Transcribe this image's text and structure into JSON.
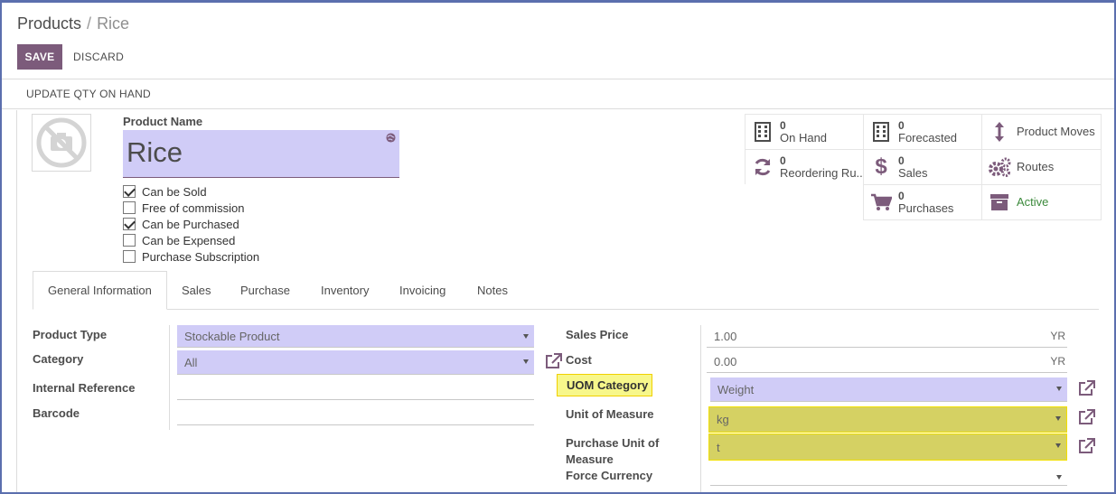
{
  "breadcrumb": {
    "parent": "Products",
    "separator": "/",
    "current": "Rice"
  },
  "buttons": {
    "save": "SAVE",
    "discard": "DISCARD",
    "update_qty": "UPDATE QTY ON HAND"
  },
  "product": {
    "name_label": "Product Name",
    "name": "Rice",
    "checkboxes": [
      {
        "label": "Can be Sold",
        "checked": true
      },
      {
        "label": "Free of commission",
        "checked": false
      },
      {
        "label": "Can be Purchased",
        "checked": true
      },
      {
        "label": "Can be Expensed",
        "checked": false
      },
      {
        "label": "Purchase Subscription",
        "checked": false
      }
    ]
  },
  "smart_buttons": {
    "on_hand": {
      "value": "0",
      "label": "On Hand",
      "icon": "building-icon"
    },
    "forecasted": {
      "value": "0",
      "label": "Forecasted",
      "icon": "building-icon"
    },
    "product_moves": {
      "label": "Product Moves",
      "icon": "arrows-v-icon"
    },
    "reordering": {
      "value": "0",
      "label": "Reordering Ru...",
      "icon": "refresh-icon"
    },
    "sales": {
      "value": "0",
      "label": "Sales",
      "icon": "dollar-icon"
    },
    "routes": {
      "label": "Routes",
      "icon": "cogs-icon"
    },
    "purchases": {
      "value": "0",
      "label": "Purchases",
      "icon": "cart-icon"
    },
    "active": {
      "label": "Active",
      "icon": "archive-icon",
      "color": "#3c8a3c"
    }
  },
  "tabs": [
    "General Information",
    "Sales",
    "Purchase",
    "Inventory",
    "Invoicing",
    "Notes"
  ],
  "general": {
    "product_type_label": "Product Type",
    "product_type": "Stockable Product",
    "category_label": "Category",
    "category": "All",
    "internal_ref_label": "Internal Reference",
    "internal_ref": "",
    "barcode_label": "Barcode",
    "barcode": "",
    "sales_price_label": "Sales Price",
    "sales_price": "1.00",
    "cost_label": "Cost",
    "cost": "0.00",
    "currency": "YR",
    "uom_category_label": "UOM Category",
    "uom_category": "Weight",
    "uom_label": "Unit of Measure",
    "uom": "kg",
    "purchase_uom_label_1": "Purchase Unit of",
    "purchase_uom_label_2": "Measure",
    "purchase_uom": "t",
    "force_currency_label": "Force Currency",
    "force_currency": ""
  },
  "colors": {
    "brand": "#7c5b7b",
    "required_field": "#d0ccf7",
    "highlight": "#d5d163"
  }
}
